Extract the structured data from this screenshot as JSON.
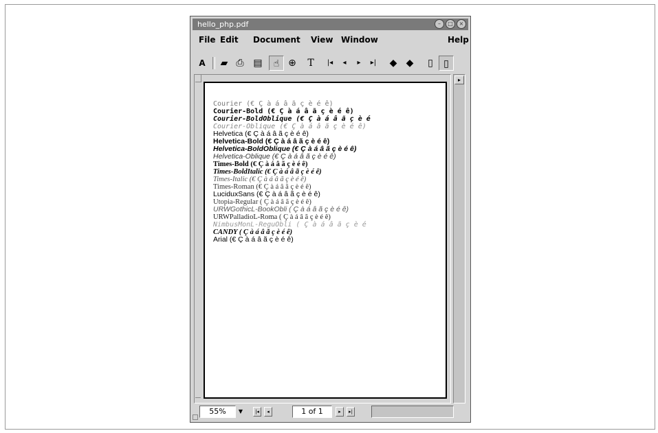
{
  "window": {
    "title": "hello_php.pdf"
  },
  "menu": [
    "File",
    "Edit",
    "Document",
    "View",
    "Window",
    "Help"
  ],
  "toolbar": {
    "icons": [
      "acrobat-logo-icon",
      "open-icon",
      "print-icon",
      "bookmarks-icon",
      "hand-tool-icon",
      "zoom-tool-icon",
      "text-select-icon",
      "first-page-icon",
      "prev-page-icon",
      "next-page-icon",
      "last-page-icon",
      "go-back-icon",
      "go-forward-icon",
      "actual-size-icon",
      "fit-page-icon"
    ]
  },
  "document": {
    "lines": [
      {
        "text": "Courier (€ Ç à á â ã ç è é ê)",
        "font": "mono",
        "weight": "normal",
        "style": "normal",
        "color": "#777777"
      },
      {
        "text": "Courier-Bold (€ Ç à á â ã ç è é ê)",
        "font": "mono",
        "weight": "bold",
        "style": "normal",
        "color": "#000000"
      },
      {
        "text": "Courier-BoldOblique (€ Ç à á â ã ç è é",
        "font": "mono",
        "weight": "bold",
        "style": "italic",
        "color": "#000000"
      },
      {
        "text": "Courier-Oblique (€ Ç à á â ã ç è é ê)",
        "font": "mono",
        "weight": "normal",
        "style": "italic",
        "color": "#888888"
      },
      {
        "text": "Helvetica (€ Ç à á â ã ç è é ê)",
        "font": "sans",
        "weight": "normal",
        "style": "normal",
        "color": "#000000"
      },
      {
        "text": "Helvetica-Bold (€ Ç à á â ã ç è é ê)",
        "font": "sans",
        "weight": "bold",
        "style": "normal",
        "color": "#000000"
      },
      {
        "text": "Helvetica-BoldOblique (€ Ç à á â ã ç è é ê)",
        "font": "sans",
        "weight": "bold",
        "style": "italic",
        "color": "#000000"
      },
      {
        "text": "Helvetica-Oblique (€ Ç à á â ã ç è é ê)",
        "font": "sans",
        "weight": "normal",
        "style": "italic",
        "color": "#333333"
      },
      {
        "text": "Times-Bold (€ Ç à á â ã ç è é ê)",
        "font": "serif",
        "weight": "bold",
        "style": "normal",
        "color": "#000000"
      },
      {
        "text": "Times-BoldItalic (€ Ç à á â ã ç è é ê)",
        "font": "serif",
        "weight": "bold",
        "style": "italic",
        "color": "#000000"
      },
      {
        "text": "Times-Italic (€ Ç à á â ã ç è é ê)",
        "font": "serif",
        "weight": "normal",
        "style": "italic",
        "color": "#555555"
      },
      {
        "text": "Times-Roman (€ Ç à á â ã ç è é ê)",
        "font": "serif",
        "weight": "normal",
        "style": "normal",
        "color": "#333333"
      },
      {
        "text": "LuciduxSans (€ Ç à á â ã ç è é ê)",
        "font": "sans",
        "weight": "normal",
        "style": "normal",
        "color": "#000000"
      },
      {
        "text": "Utopia-Regular ( Ç à á â ã ç è é ê)",
        "font": "serif",
        "weight": "normal",
        "style": "normal",
        "color": "#333333"
      },
      {
        "text": "URWGothicL-BookObli ( Ç à á â ã ç è é ê)",
        "font": "sans",
        "weight": "normal",
        "style": "italic",
        "color": "#555555"
      },
      {
        "text": "URWPalladioL-Roma ( Ç à á â ã ç è é ê)",
        "font": "serif",
        "weight": "normal",
        "style": "normal",
        "color": "#222222"
      },
      {
        "text": "NimbusMonL-ReguObli ( Ç à á â ã ç è é",
        "font": "mono",
        "weight": "normal",
        "style": "italic",
        "color": "#999999"
      },
      {
        "text": "CANDY ( Ç à á â ã ç è é ê)",
        "font": "serif",
        "weight": "bold",
        "style": "italic",
        "color": "#000000"
      },
      {
        "text": "Arial (€ Ç à á â ã ç è é ê)",
        "font": "sans",
        "weight": "normal",
        "style": "normal",
        "color": "#000000"
      }
    ]
  },
  "statusbar": {
    "zoom": "55%",
    "page": "1 of 1"
  }
}
